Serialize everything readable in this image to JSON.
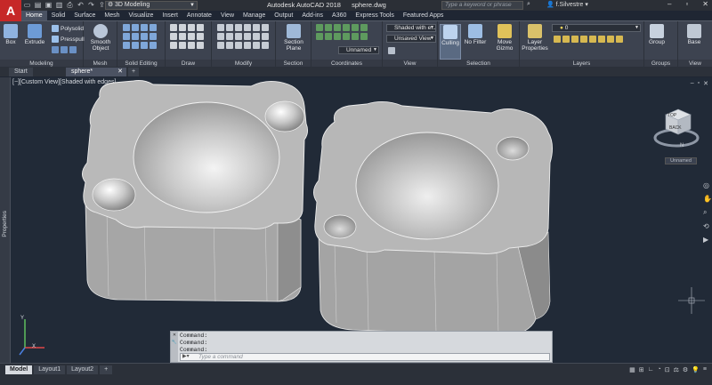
{
  "app": {
    "logo_letter": "A",
    "title": "Autodesk AutoCAD 2018",
    "filename": "sphere.dwg",
    "workspace": "3D Modeling",
    "search_placeholder": "Type a keyword or phrase",
    "user": "f.Silvestre"
  },
  "ribbon_tabs": [
    "Home",
    "Solid",
    "Surface",
    "Mesh",
    "Visualize",
    "Insert",
    "Annotate",
    "View",
    "Manage",
    "Output",
    "Add-ins",
    "A360",
    "Express Tools",
    "Featured Apps"
  ],
  "ribbon": {
    "modeling": {
      "title": "Modeling",
      "box": "Box",
      "extrude": "Extrude",
      "polysolid": "Polysolid",
      "presspull": "Presspull"
    },
    "mesh": {
      "title": "Mesh",
      "smooth_object": "Smooth Object"
    },
    "solid_editing": {
      "title": "Solid Editing"
    },
    "draw": {
      "title": "Draw"
    },
    "modify": {
      "title": "Modify"
    },
    "section": {
      "title": "Section",
      "section_plane": "Section Plane"
    },
    "coordinates": {
      "title": "Coordinates",
      "ucs_combo": "Unnamed"
    },
    "view": {
      "title": "View",
      "visual_style": "Shaded with e...",
      "saved_view": "Unsaved View"
    },
    "selection": {
      "title": "Selection",
      "culling": "Culling",
      "no_filter": "No Filter",
      "move_gizmo": "Move Gizmo"
    },
    "layers": {
      "title": "Layers",
      "layer_properties": "Layer Properties",
      "layer_combo": "0"
    },
    "groups": {
      "title": "Groups",
      "group": "Group"
    },
    "view2": {
      "title": "View",
      "base": "Base"
    }
  },
  "doc_tabs": {
    "start": "Start",
    "current": "sphere*"
  },
  "viewport": {
    "label": "[−][Custom View][Shaded with edges]",
    "viewcube_top": "TOP",
    "viewcube_front": "BACK",
    "compass_n": "N",
    "ucs_badge": "Unnamed",
    "ucs_x": "X",
    "ucs_y": "Y",
    "side_palette": "Properties"
  },
  "command": {
    "history": [
      "Command:",
      "Command:",
      "Command:"
    ],
    "placeholder": "Type a command"
  },
  "layout_tabs": {
    "model": "Model",
    "layout1": "Layout1",
    "layout2": "Layout2"
  }
}
